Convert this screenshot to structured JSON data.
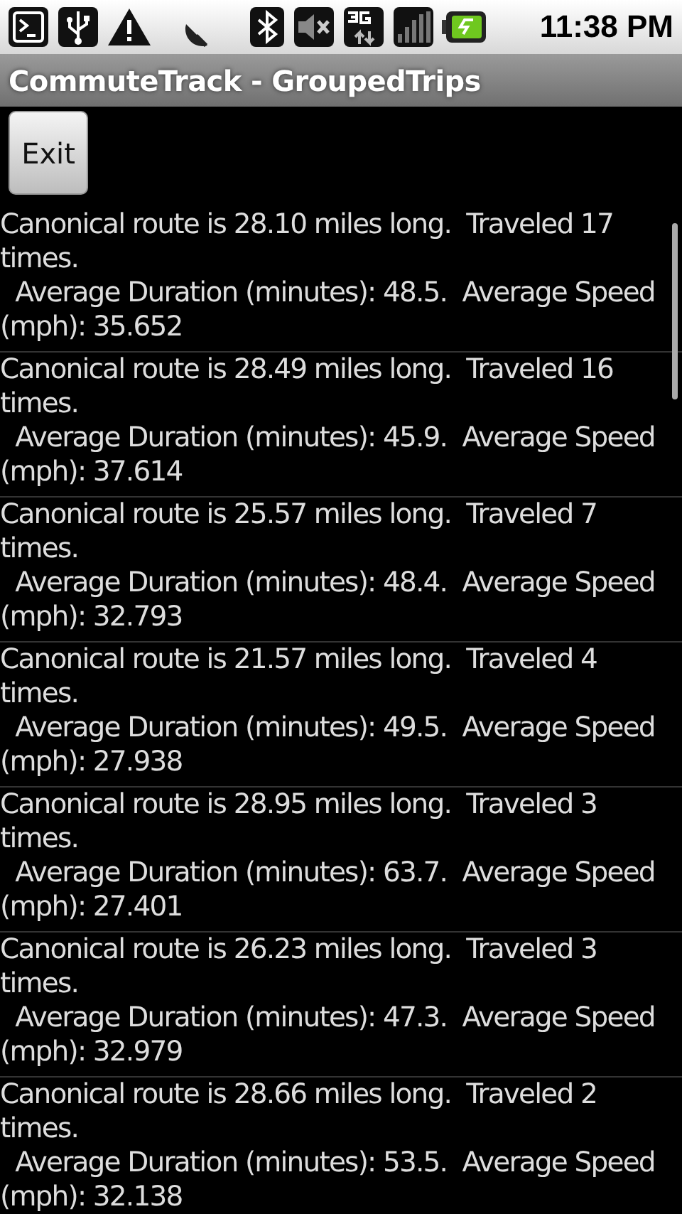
{
  "status_bar": {
    "time": "11:38 PM"
  },
  "window": {
    "title": "CommuteTrack - GroupedTrips"
  },
  "exit_button": {
    "label": "Exit"
  },
  "trips": [
    {
      "summary": "Canonical route is 28.10 miles long.  Traveled 17 times.",
      "stats": "  Average Duration (minutes): 48.5.  Average Speed (mph): 35.652"
    },
    {
      "summary": "Canonical route is 28.49 miles long.  Traveled 16 times.",
      "stats": "  Average Duration (minutes): 45.9.  Average Speed (mph): 37.614"
    },
    {
      "summary": "Canonical route is 25.57 miles long.  Traveled 7 times.",
      "stats": "  Average Duration (minutes): 48.4.  Average Speed (mph): 32.793"
    },
    {
      "summary": "Canonical route is 21.57 miles long.  Traveled 4 times.",
      "stats": "  Average Duration (minutes): 49.5.  Average Speed (mph): 27.938"
    },
    {
      "summary": "Canonical route is 28.95 miles long.  Traveled 3 times.",
      "stats": "  Average Duration (minutes): 63.7.  Average Speed (mph): 27.401"
    },
    {
      "summary": "Canonical route is 26.23 miles long.  Traveled 3 times.",
      "stats": "  Average Duration (minutes): 47.3.  Average Speed (mph): 32.979"
    },
    {
      "summary": "Canonical route is 28.66 miles long.  Traveled 2 times.",
      "stats": "  Average Duration (minutes): 53.5.  Average Speed (mph): 32.138"
    }
  ]
}
